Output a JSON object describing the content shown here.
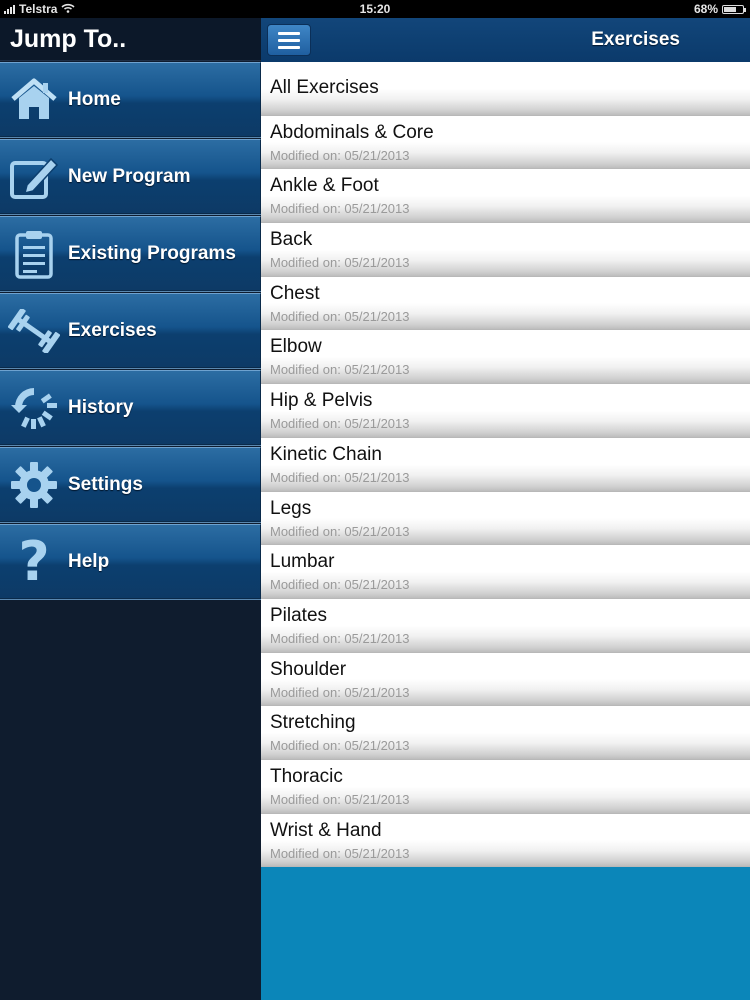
{
  "status_bar": {
    "carrier": "Telstra",
    "time": "15:20",
    "battery": "68%",
    "battery_level": 0.68
  },
  "sidebar": {
    "title": "Jump To..",
    "items": [
      {
        "label": "Home",
        "icon": "home-icon"
      },
      {
        "label": "New Program",
        "icon": "edit-icon"
      },
      {
        "label": "Existing Programs",
        "icon": "clipboard-icon"
      },
      {
        "label": "Exercises",
        "icon": "dumbbell-icon"
      },
      {
        "label": "History",
        "icon": "history-icon"
      },
      {
        "label": "Settings",
        "icon": "gear-icon"
      },
      {
        "label": "Help",
        "icon": "question-icon"
      }
    ]
  },
  "header": {
    "title": "Exercises",
    "menu_icon": "hamburger-icon"
  },
  "list": {
    "all_label": "All Exercises",
    "items": [
      {
        "title": "Abdominals & Core",
        "modified": "Modified on: 05/21/2013"
      },
      {
        "title": "Ankle & Foot",
        "modified": "Modified on: 05/21/2013"
      },
      {
        "title": "Back",
        "modified": "Modified on: 05/21/2013"
      },
      {
        "title": "Chest",
        "modified": "Modified on: 05/21/2013"
      },
      {
        "title": "Elbow",
        "modified": "Modified on: 05/21/2013"
      },
      {
        "title": "Hip & Pelvis",
        "modified": "Modified on: 05/21/2013"
      },
      {
        "title": "Kinetic Chain",
        "modified": "Modified on: 05/21/2013"
      },
      {
        "title": "Legs",
        "modified": "Modified on: 05/21/2013"
      },
      {
        "title": "Lumbar",
        "modified": "Modified on: 05/21/2013"
      },
      {
        "title": "Pilates",
        "modified": "Modified on: 05/21/2013"
      },
      {
        "title": "Shoulder",
        "modified": "Modified on: 05/21/2013"
      },
      {
        "title": "Stretching",
        "modified": "Modified on: 05/21/2013"
      },
      {
        "title": "Thoracic",
        "modified": "Modified on: 05/21/2013"
      },
      {
        "title": "Wrist & Hand",
        "modified": "Modified on: 05/21/2013"
      }
    ]
  },
  "colors": {
    "sidebar_bg": "#0f1c2e",
    "nav_button": "#15548c",
    "content_bg": "#0b86b9",
    "header_bar": "#0b3a6b"
  }
}
